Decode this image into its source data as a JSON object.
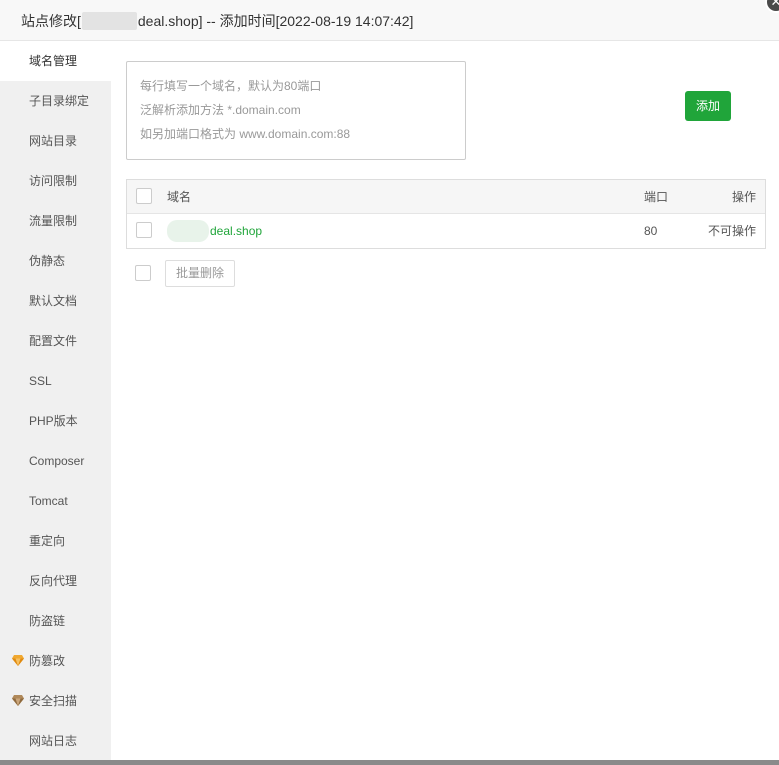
{
  "window": {
    "title_prefix": "站点修改[",
    "title_suffix": "deal.shop] -- 添加时间[2022-08-19 14:07:42]",
    "close_glyph": "✕"
  },
  "sidebar": {
    "items": [
      {
        "label": "域名管理",
        "active": true
      },
      {
        "label": "子目录绑定"
      },
      {
        "label": "网站目录"
      },
      {
        "label": "访问限制"
      },
      {
        "label": "流量限制"
      },
      {
        "label": "伪静态"
      },
      {
        "label": "默认文档"
      },
      {
        "label": "配置文件"
      },
      {
        "label": "SSL"
      },
      {
        "label": "PHP版本"
      },
      {
        "label": "Composer"
      },
      {
        "label": "Tomcat"
      },
      {
        "label": "重定向"
      },
      {
        "label": "反向代理"
      },
      {
        "label": "防盗链"
      },
      {
        "label": "防篡改",
        "icon": "gold-gem-icon"
      },
      {
        "label": "安全扫描",
        "icon": "bronze-gem-icon"
      },
      {
        "label": "网站日志"
      }
    ]
  },
  "domain_input": {
    "hint_lines": [
      "每行填写一个域名，默认为80端口",
      "泛解析添加方法 *.domain.com",
      "如另加端口格式为 www.domain.com:88"
    ]
  },
  "add_button": {
    "label": "添加"
  },
  "table": {
    "headers": {
      "name": "域名",
      "port": "端口",
      "action": "操作"
    },
    "rows": [
      {
        "domain": "deal.shop",
        "port": "80",
        "action": "不可操作"
      }
    ]
  },
  "bulk_delete": {
    "label": "批量删除"
  },
  "colors": {
    "accent": "#20a53a",
    "sidebar_bg": "#f0f0f0",
    "gem_gold": "#f0a830",
    "gem_bronze": "#b0895a"
  }
}
